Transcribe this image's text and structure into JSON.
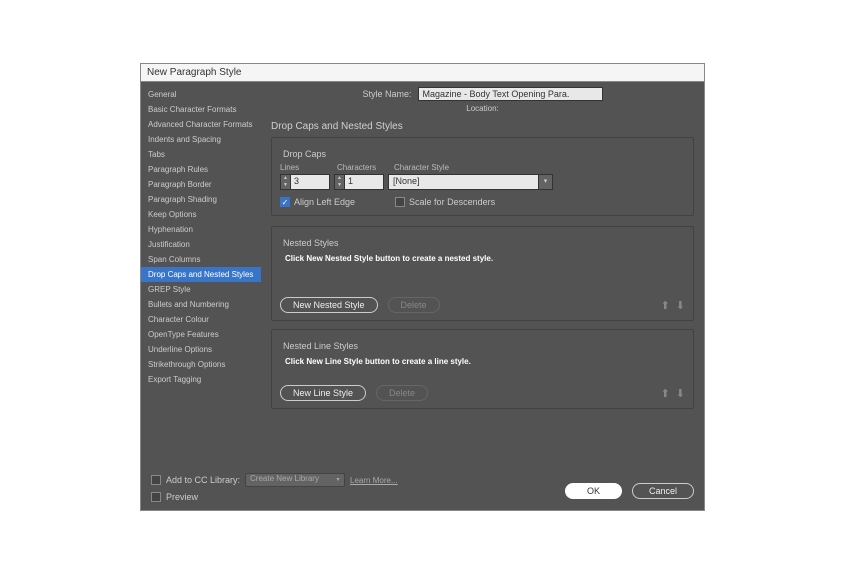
{
  "dialog": {
    "title": "New Paragraph Style"
  },
  "sidebar": {
    "items": [
      "General",
      "Basic Character Formats",
      "Advanced Character Formats",
      "Indents and Spacing",
      "Tabs",
      "Paragraph Rules",
      "Paragraph Border",
      "Paragraph Shading",
      "Keep Options",
      "Hyphenation",
      "Justification",
      "Span Columns",
      "Drop Caps and Nested Styles",
      "GREP Style",
      "Bullets and Numbering",
      "Character Colour",
      "OpenType Features",
      "Underline Options",
      "Strikethrough Options",
      "Export Tagging"
    ],
    "selected_index": 12
  },
  "header": {
    "style_name_label": "Style Name:",
    "style_name_value": "Magazine - Body Text Opening Para.",
    "location_label": "Location:"
  },
  "section_title": "Drop Caps and Nested Styles",
  "drop_caps": {
    "group_title": "Drop Caps",
    "lines_label": "Lines",
    "lines_value": "3",
    "characters_label": "Characters",
    "characters_value": "1",
    "char_style_label": "Character Style",
    "char_style_value": "[None]",
    "align_left_label": "Align Left Edge",
    "align_left_checked": true,
    "scale_label": "Scale for Descenders",
    "scale_checked": false
  },
  "nested_styles": {
    "group_title": "Nested Styles",
    "hint": "Click New Nested Style button to create a nested style.",
    "new_button": "New Nested Style",
    "delete_button": "Delete"
  },
  "nested_line_styles": {
    "group_title": "Nested Line Styles",
    "hint": "Click New Line Style button to create a line style.",
    "new_button": "New Line Style",
    "delete_button": "Delete"
  },
  "footer": {
    "add_cc_label": "Add to CC Library:",
    "cc_dropdown_value": "Create New Library",
    "learn_more": "Learn More...",
    "preview_label": "Preview",
    "ok": "OK",
    "cancel": "Cancel"
  }
}
